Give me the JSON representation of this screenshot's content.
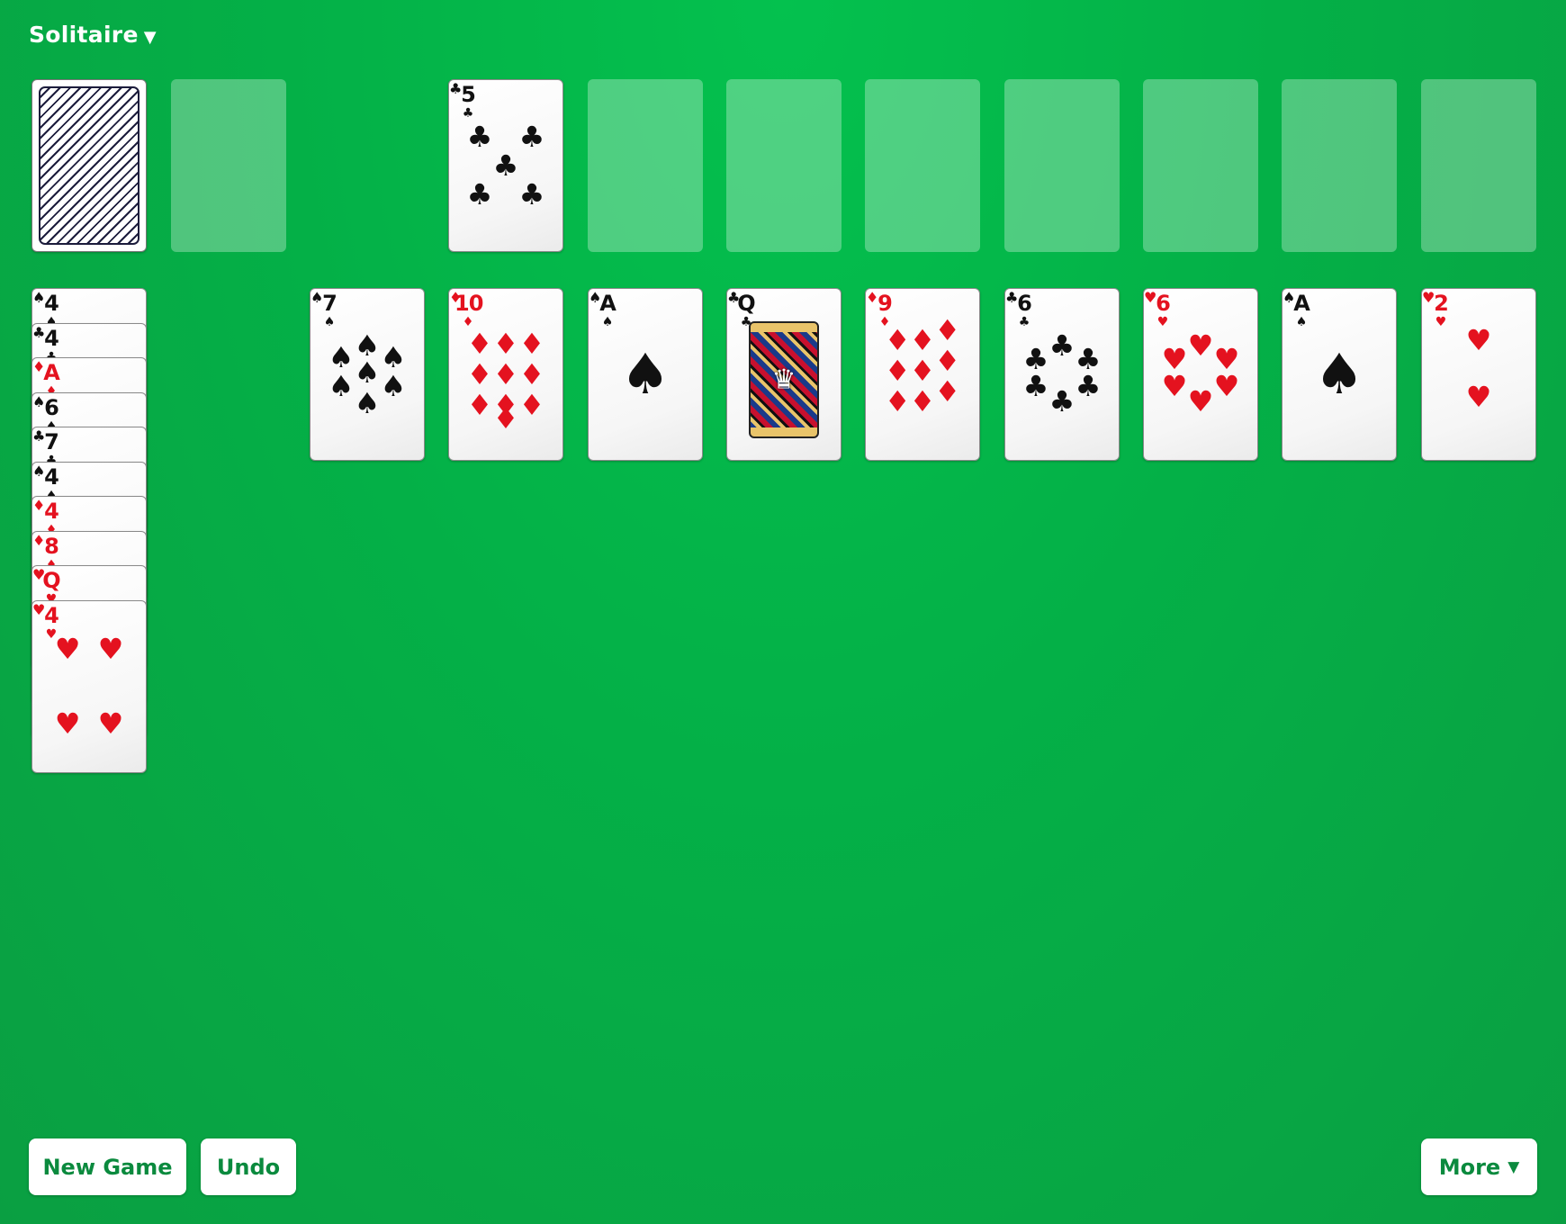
{
  "app": {
    "title": "Solitaire",
    "title_caret": "▼"
  },
  "colors": {
    "felt": "#04b047",
    "button_text": "#0b8a3e",
    "red_suit": "#e4121f",
    "black_suit": "#111111"
  },
  "stock": {
    "face_down": true
  },
  "foundation_top": {
    "rank": "5",
    "suit": "♣",
    "color": "black"
  },
  "tableau": [
    {
      "rank": "7",
      "suit": "♠",
      "color": "black"
    },
    {
      "rank": "10",
      "suit": "♦",
      "color": "red"
    },
    {
      "rank": "A",
      "suit": "♠",
      "color": "black"
    },
    {
      "rank": "Q",
      "suit": "♣",
      "color": "black"
    },
    {
      "rank": "9",
      "suit": "♦",
      "color": "red"
    },
    {
      "rank": "6",
      "suit": "♣",
      "color": "black"
    },
    {
      "rank": "6",
      "suit": "♥",
      "color": "red"
    },
    {
      "rank": "A",
      "suit": "♠",
      "color": "black"
    },
    {
      "rank": "2",
      "suit": "♥",
      "color": "red"
    }
  ],
  "reserve_stack": [
    {
      "rank": "4",
      "suit": "♠",
      "color": "black"
    },
    {
      "rank": "4",
      "suit": "♣",
      "color": "black"
    },
    {
      "rank": "A",
      "suit": "♦",
      "color": "red"
    },
    {
      "rank": "6",
      "suit": "♠",
      "color": "black"
    },
    {
      "rank": "7",
      "suit": "♣",
      "color": "black"
    },
    {
      "rank": "4",
      "suit": "♠",
      "color": "black"
    },
    {
      "rank": "4",
      "suit": "♦",
      "color": "red"
    },
    {
      "rank": "8",
      "suit": "♦",
      "color": "red"
    },
    {
      "rank": "Q",
      "suit": "♥",
      "color": "red"
    },
    {
      "rank": "4",
      "suit": "♥",
      "color": "red"
    }
  ],
  "buttons": {
    "new_game": "New Game",
    "undo": "Undo",
    "more": "More",
    "more_caret": "▼"
  }
}
